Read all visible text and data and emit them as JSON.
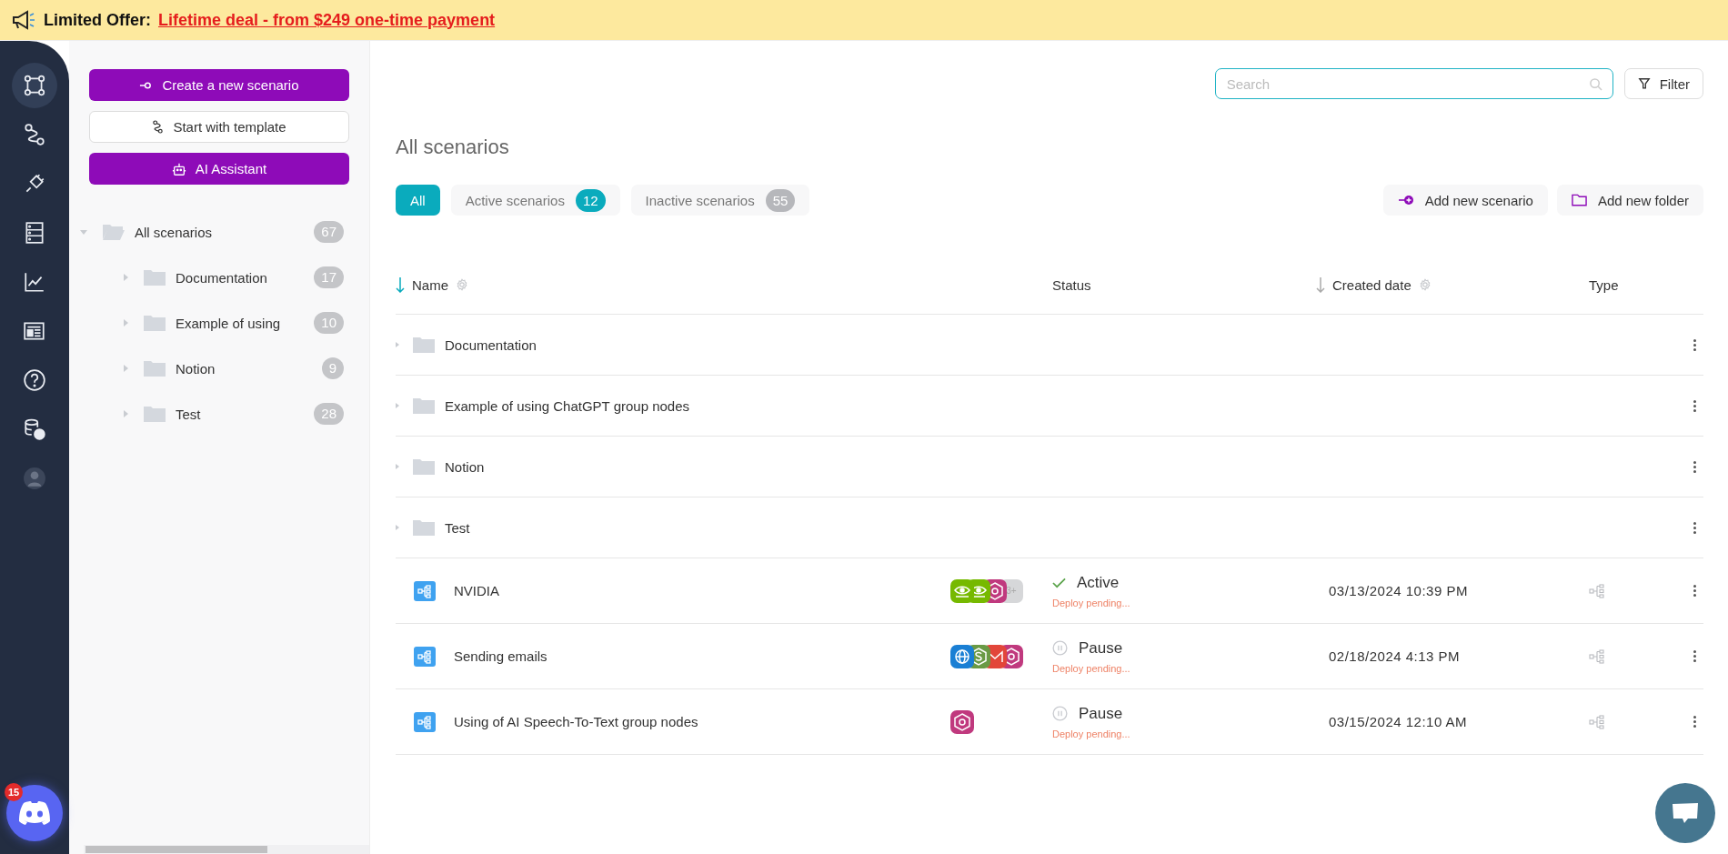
{
  "banner": {
    "label": "Limited Offer:",
    "link": "Lifetime deal - from $249 one-time payment"
  },
  "rail": [
    {
      "kind": "nodes",
      "selected": true
    },
    {
      "kind": "route",
      "selected": false
    },
    {
      "kind": "plug",
      "selected": false
    },
    {
      "kind": "server",
      "selected": false
    },
    {
      "kind": "chart",
      "selected": false
    },
    {
      "kind": "news",
      "selected": false
    },
    {
      "kind": "help",
      "selected": false
    },
    {
      "kind": "billing",
      "selected": false
    },
    {
      "kind": "user",
      "selected": false
    }
  ],
  "discord": {
    "badge": "15"
  },
  "panel": {
    "buttons": [
      {
        "kind": "create",
        "label": "Create a new scenario"
      },
      {
        "kind": "template",
        "label": "Start with template"
      },
      {
        "kind": "ai",
        "label": "AI Assistant"
      }
    ],
    "tree": {
      "label": "All scenarios",
      "count": "67",
      "expanded": true,
      "children": [
        {
          "label": "Documentation",
          "count": "17",
          "expanded": false
        },
        {
          "label": "Example of using",
          "count": "10",
          "expanded": false
        },
        {
          "label": "Notion",
          "count": "9",
          "expanded": false
        },
        {
          "label": "Test",
          "count": "28",
          "expanded": false
        }
      ]
    }
  },
  "search": {
    "placeholder": "Search"
  },
  "filter_button": "Filter",
  "title": "All scenarios",
  "tabs": [
    {
      "label": "All",
      "selected": true
    },
    {
      "label": "Active scenarios",
      "count": "12",
      "selected": false,
      "color": "#0aabbd"
    },
    {
      "label": "Inactive scenarios",
      "count": "55",
      "selected": false,
      "color": "#b6b7bb"
    }
  ],
  "actions": [
    {
      "kind": "scenario",
      "label": "Add new scenario"
    },
    {
      "kind": "folder",
      "label": "Add new folder"
    }
  ],
  "table": {
    "columns": [
      {
        "label": "Name",
        "sorted": true,
        "settings": true
      },
      {
        "label": "Status"
      },
      {
        "label": "Created date",
        "sorted": false,
        "settings": true
      },
      {
        "label": "Type"
      }
    ],
    "folders": [
      {
        "name": "Documentation",
        "expanded": false
      },
      {
        "name": "Example of using ChatGPT group nodes",
        "expanded": false
      },
      {
        "name": "Notion",
        "expanded": false
      },
      {
        "name": "Test",
        "expanded": false
      }
    ],
    "scenarios": [
      {
        "name": "NVIDIA",
        "apps": [
          {
            "kind": "eye",
            "color": "#76b900"
          },
          {
            "kind": "eye",
            "color": "#76b900"
          },
          {
            "kind": "hex",
            "color": "#c0397e"
          }
        ],
        "more": "3+",
        "active": true,
        "status": "Active",
        "note": "Deploy pending...",
        "created": "03/13/2024 10:39 PM"
      },
      {
        "name": "Sending emails",
        "apps": [
          {
            "kind": "globe",
            "color": "#1a7fd4"
          },
          {
            "kind": "coin",
            "color": "#6a9a45"
          },
          {
            "kind": "envelope",
            "color": "#e2463a"
          },
          {
            "kind": "hex",
            "color": "#c0397e"
          }
        ],
        "active": false,
        "status": "Pause",
        "note": "Deploy pending...",
        "created": "02/18/2024 4:13 PM"
      },
      {
        "name": "Using of AI Speech-To-Text group nodes",
        "apps": [
          {
            "kind": "hex",
            "color": "#c0397e"
          }
        ],
        "active": false,
        "status": "Pause",
        "note": "Deploy pending...",
        "created": "03/15/2024 12:10 AM"
      }
    ]
  }
}
